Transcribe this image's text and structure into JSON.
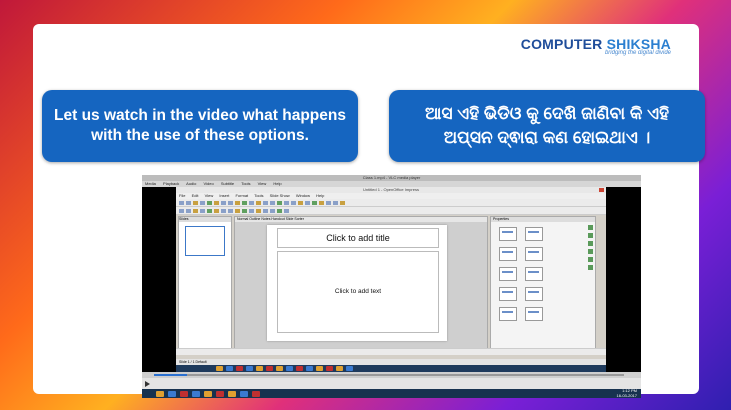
{
  "brand": {
    "name_part1": "COMPUTER",
    "name_part2": " SHIKSHA",
    "tagline": "bridging the digital divide"
  },
  "bubbles": {
    "english": "Let us watch in the video what happens with the use of these options.",
    "odia": "ଆସ ଏହି ଭିଡିଓ କୁ ଦେଖି ଜାଣିବା କି ଏହି ଅପ୍ସନ ଦ୍ଵାରା କଣ ହୋଇଥାଏ ।"
  },
  "video": {
    "player_title": "Class 1.mp4 - VLC media player",
    "player_menu": [
      "Media",
      "Playback",
      "Audio",
      "Video",
      "Subtitle",
      "Tools",
      "View",
      "Help"
    ],
    "app_title": "Untitled 1 - OpenOffice Impress",
    "app_menu": [
      "File",
      "Edit",
      "View",
      "Insert",
      "Format",
      "Tools",
      "Slide Show",
      "Window",
      "Help"
    ],
    "slides_pane_header": "Slides",
    "workspace_tabs": "Normal  Outline  Notes  Handout  Slide Sorter",
    "placeholder_title": "Click to add title",
    "placeholder_text": "Click to add text",
    "properties_header": "Properties",
    "status_text": "Slide 1 / 1     Default",
    "progress": 0.07,
    "clock_time": "1:12 PM",
    "clock_date": "16-03-2017"
  },
  "colors": {
    "bubble": "#1565c0",
    "brand": "#1f4d9a"
  }
}
